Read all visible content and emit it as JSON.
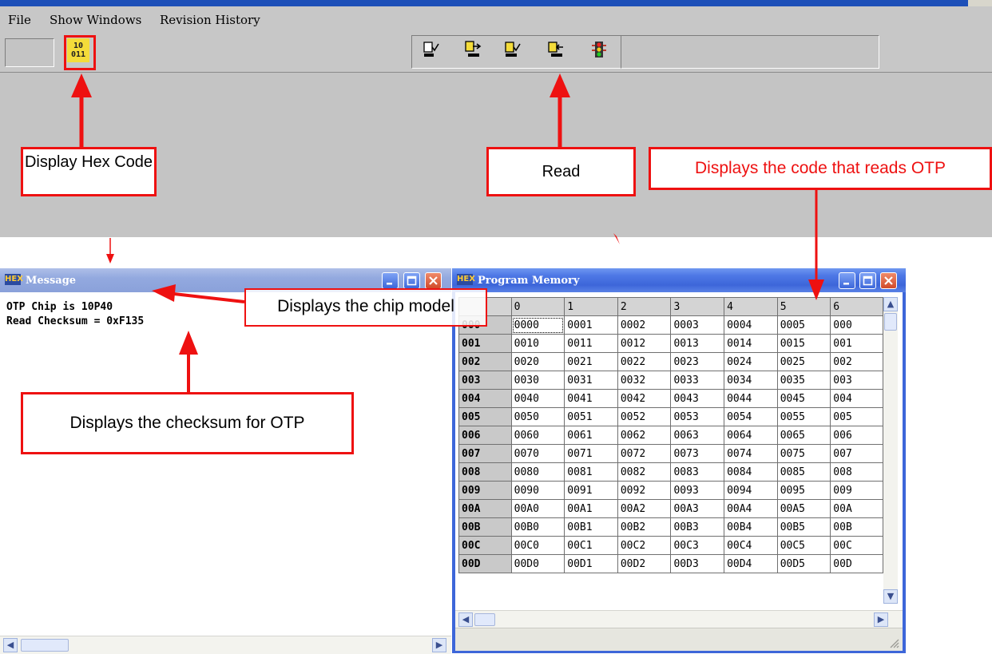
{
  "menu": {
    "file": "File",
    "show_windows": "Show Windows",
    "revision_history": "Revision History"
  },
  "toolbar": {
    "hex_icon_line1": "10",
    "hex_icon_line2": "011",
    "icons": [
      "document-check-icon",
      "document-export-icon",
      "document-verify-icon",
      "document-import-icon",
      "traffic-light-icon"
    ]
  },
  "annotations": {
    "display_hex_code": "Display Hex Code",
    "read": "Read",
    "displays_code_reads_otp": "Displays the code that reads OTP",
    "displays_chip_model": "Displays the chip model",
    "displays_checksum": "Displays the checksum for OTP"
  },
  "message_window": {
    "icon_label": "HEX",
    "title": "Message",
    "line1": "OTP Chip is 10P40",
    "line2": "Read Checksum = 0xF135"
  },
  "program_memory_window": {
    "icon_label": "HEX",
    "title": "Program Memory",
    "columns": [
      "0",
      "1",
      "2",
      "3",
      "4",
      "5",
      "6"
    ],
    "rows": [
      {
        "addr": "000",
        "cells": [
          "0000",
          "0001",
          "0002",
          "0003",
          "0004",
          "0005",
          "000"
        ]
      },
      {
        "addr": "001",
        "cells": [
          "0010",
          "0011",
          "0012",
          "0013",
          "0014",
          "0015",
          "001"
        ]
      },
      {
        "addr": "002",
        "cells": [
          "0020",
          "0021",
          "0022",
          "0023",
          "0024",
          "0025",
          "002"
        ]
      },
      {
        "addr": "003",
        "cells": [
          "0030",
          "0031",
          "0032",
          "0033",
          "0034",
          "0035",
          "003"
        ]
      },
      {
        "addr": "004",
        "cells": [
          "0040",
          "0041",
          "0042",
          "0043",
          "0044",
          "0045",
          "004"
        ]
      },
      {
        "addr": "005",
        "cells": [
          "0050",
          "0051",
          "0052",
          "0053",
          "0054",
          "0055",
          "005"
        ]
      },
      {
        "addr": "006",
        "cells": [
          "0060",
          "0061",
          "0062",
          "0063",
          "0064",
          "0065",
          "006"
        ]
      },
      {
        "addr": "007",
        "cells": [
          "0070",
          "0071",
          "0072",
          "0073",
          "0074",
          "0075",
          "007"
        ]
      },
      {
        "addr": "008",
        "cells": [
          "0080",
          "0081",
          "0082",
          "0083",
          "0084",
          "0085",
          "008"
        ]
      },
      {
        "addr": "009",
        "cells": [
          "0090",
          "0091",
          "0092",
          "0093",
          "0094",
          "0095",
          "009"
        ]
      },
      {
        "addr": "00A",
        "cells": [
          "00A0",
          "00A1",
          "00A2",
          "00A3",
          "00A4",
          "00A5",
          "00A"
        ]
      },
      {
        "addr": "00B",
        "cells": [
          "00B0",
          "00B1",
          "00B2",
          "00B3",
          "00B4",
          "00B5",
          "00B"
        ]
      },
      {
        "addr": "00C",
        "cells": [
          "00C0",
          "00C1",
          "00C2",
          "00C3",
          "00C4",
          "00C5",
          "00C"
        ]
      },
      {
        "addr": "00D",
        "cells": [
          "00D0",
          "00D1",
          "00D2",
          "00D3",
          "00D4",
          "00D5",
          "00D"
        ]
      }
    ]
  },
  "colors": {
    "annotation_red": "#ee1111",
    "titlebar_blue": "#3d66d9",
    "toolbar_gray": "#c7c7c7",
    "hex_icon_yellow": "#f4dc3a"
  }
}
